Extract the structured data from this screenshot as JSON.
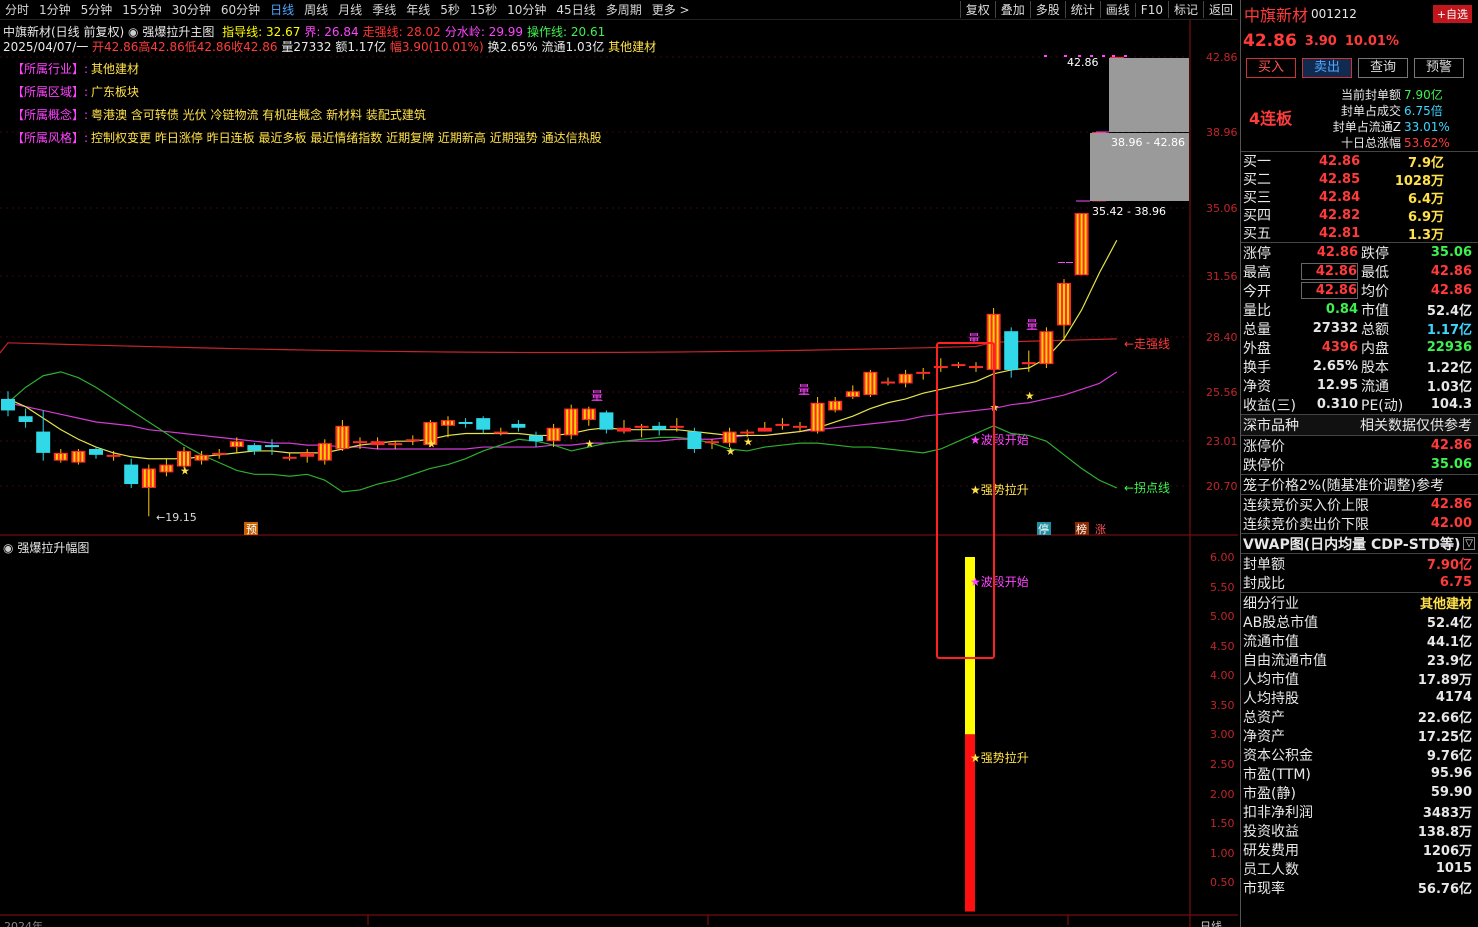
{
  "toolbar": {
    "timeframes": [
      "分时",
      "1分钟",
      "5分钟",
      "15分钟",
      "30分钟",
      "60分钟",
      "日线",
      "周线",
      "月线",
      "季线",
      "年线",
      "5秒",
      "15秒",
      "10分钟",
      "45日线",
      "多周期",
      "更多 >"
    ],
    "active_timeframe": "日线",
    "tools": [
      "复权",
      "叠加",
      "多股",
      "统计",
      "画线",
      "F10",
      "标记",
      "返回"
    ]
  },
  "chart_header": {
    "title": "中旗新材(日线 前复权)",
    "indicator_name": "强爆拉升主图",
    "params": [
      {
        "label": "指导线: 32.67",
        "color": "#ffff00"
      },
      {
        "label": "界: 26.84",
        "color": "#ff44ff"
      },
      {
        "label": "走强线: 28.02",
        "color": "#ff3333"
      },
      {
        "label": "分水岭: 29.99",
        "color": "#ff44ff"
      },
      {
        "label": "操作线: 20.61",
        "color": "#3ef14e"
      }
    ]
  },
  "bar_info": {
    "date": "2025/04/07/一",
    "open": "开42.86",
    "high": "高42.86",
    "low": "低42.86",
    "close": "收42.86",
    "volume": "量27332",
    "amount": "额1.17亿",
    "change": "幅3.90(10.01%)",
    "turnover": "换2.65%",
    "float": "流通1.03亿",
    "industry": "其他建材"
  },
  "tags": [
    {
      "key": "【所属行业】:",
      "value": "其他建材"
    },
    {
      "key": "【所属区域】:",
      "value": "广东板块"
    },
    {
      "key": "【所属概念】:",
      "value": "粤港澳 含可转债 光伏 冷链物流 有机硅概念 新材料 装配式建筑"
    },
    {
      "key": "【所属风格】:",
      "value": "控制权变更 昨日涨停 昨日连板 最近多板 最近情绪指数 近期复牌 近期新高 近期强势 通达信热股"
    }
  ],
  "price_axis": [
    "42.86",
    "38.96",
    "35.06",
    "31.56",
    "28.40",
    "25.56",
    "23.01",
    "20.70"
  ],
  "sub_axis": [
    "6.00",
    "5.50",
    "5.00",
    "4.50",
    "4.00",
    "3.50",
    "3.00",
    "2.50",
    "2.00",
    "1.50",
    "1.00",
    "0.50"
  ],
  "annotations": {
    "low_marker": "←19.15",
    "high_label": "42.86",
    "box1_label": "38.96 - 42.86",
    "box2_label": "35.42 - 38.96",
    "line_strong": "←走强线",
    "line_turn": "←拐点线",
    "wave_start": "★波段开始",
    "strong_rise": "★强势拉升",
    "vol_mark": "量",
    "yu_mark": "预",
    "ting_mark": "停",
    "bang_mark": "榜",
    "zhang_mark": "涨",
    "sub_wave_start": "★波段开始",
    "sub_strong_rise": "★强势拉升"
  },
  "sub_chart": {
    "title": "强爆拉升幅图"
  },
  "bottom_axis": {
    "left": "2024年",
    "right": "日线"
  },
  "quote": {
    "name": "中旗新材",
    "code": "001212",
    "price": "42.86",
    "change": "3.90",
    "pct": "10.01%",
    "add_fav": "+自选",
    "buttons": [
      "买入",
      "卖出",
      "查询",
      "预警"
    ],
    "streak": "4连板",
    "seal": [
      {
        "k": "当前封单额",
        "v": "7.90亿",
        "c": "grn"
      },
      {
        "k": "封单占成交",
        "v": "6.75倍",
        "c": "cyn"
      },
      {
        "k": "封单占流通Z",
        "v": "33.01%",
        "c": "cyn"
      },
      {
        "k": "十日总涨幅",
        "v": "53.62%",
        "c": "red"
      }
    ],
    "bids": [
      {
        "k": "买一",
        "p": "42.86",
        "v": "7.9亿"
      },
      {
        "k": "买二",
        "p": "42.85",
        "v": "1028万"
      },
      {
        "k": "买三",
        "p": "42.84",
        "v": "6.4万"
      },
      {
        "k": "买四",
        "p": "42.82",
        "v": "6.9万"
      },
      {
        "k": "买五",
        "p": "42.81",
        "v": "1.3万"
      }
    ],
    "stats": [
      {
        "k1": "涨停",
        "v1": "42.86",
        "c1": "red",
        "k2": "跌停",
        "v2": "35.06",
        "c2": "grn"
      },
      {
        "k1": "最高",
        "v1": "42.86",
        "c1": "red",
        "k2": "最低",
        "v2": "42.86",
        "c2": "red"
      },
      {
        "k1": "今开",
        "v1": "42.86",
        "c1": "red",
        "k2": "均价",
        "v2": "42.86",
        "c2": "red"
      },
      {
        "k1": "量比",
        "v1": "0.84",
        "c1": "grn",
        "k2": "市值",
        "v2": "52.4亿",
        "c2": "wht"
      },
      {
        "k1": "总量",
        "v1": "27332",
        "c1": "wht",
        "k2": "总额",
        "v2": "1.17亿",
        "c2": "cyn"
      },
      {
        "k1": "外盘",
        "v1": "4396",
        "c1": "red",
        "k2": "内盘",
        "v2": "22936",
        "c2": "grn"
      },
      {
        "k1": "换手",
        "v1": "2.65%",
        "c1": "wht",
        "k2": "股本",
        "v2": "1.22亿",
        "c2": "wht"
      },
      {
        "k1": "净资",
        "v1": "12.95",
        "c1": "wht",
        "k2": "流通",
        "v2": "1.03亿",
        "c2": "wht"
      },
      {
        "k1": "收益(三)",
        "v1": "0.310",
        "c1": "wht",
        "k2": "PE(动)",
        "v2": "104.3",
        "c2": "wht"
      }
    ],
    "section_title": "深市品种",
    "section_sub": "相关数据仅供参考",
    "limits": [
      {
        "k": "涨停价",
        "v": "42.86",
        "c": "red"
      },
      {
        "k": "跌停价",
        "v": "35.06",
        "c": "grn"
      }
    ],
    "cage_title": "笼子价格2%(随基准价调整)参考",
    "cage": [
      {
        "k": "连续竞价买入价上限",
        "v": "42.86",
        "c": "red"
      },
      {
        "k": "连续竞价卖出价下限",
        "v": "42.00",
        "c": "red"
      }
    ],
    "vwap_title": "VWAP图(日内均量 CDP-STD等)",
    "seal2": [
      {
        "k": "封单额",
        "v": "7.90亿",
        "c": "red"
      },
      {
        "k": "封成比",
        "v": "6.75",
        "c": "red"
      }
    ],
    "fundamentals": [
      {
        "k": "细分行业",
        "v": "其他建材",
        "c": "yel"
      },
      {
        "k": "AB股总市值",
        "v": "52.4亿",
        "c": "wht"
      },
      {
        "k": "流通市值",
        "v": "44.1亿",
        "c": "wht"
      },
      {
        "k": "自由流通市值",
        "v": "23.9亿",
        "c": "wht"
      },
      {
        "k": "人均市值",
        "v": "17.89万",
        "c": "wht"
      },
      {
        "k": "人均持股",
        "v": "4174",
        "c": "wht"
      },
      {
        "k": "总资产",
        "v": "22.66亿",
        "c": "wht"
      },
      {
        "k": "净资产",
        "v": "17.25亿",
        "c": "wht"
      },
      {
        "k": "资本公积金",
        "v": "9.76亿",
        "c": "wht"
      },
      {
        "k": "市盈(TTM)",
        "v": "95.96",
        "c": "wht"
      },
      {
        "k": "市盈(静)",
        "v": "59.90",
        "c": "wht"
      },
      {
        "k": "扣非净利润",
        "v": "3483万",
        "c": "wht"
      },
      {
        "k": "投资收益",
        "v": "138.8万",
        "c": "wht"
      },
      {
        "k": "研发费用",
        "v": "1206万",
        "c": "wht"
      },
      {
        "k": "员工人数",
        "v": "1015",
        "c": "wht"
      },
      {
        "k": "市现率",
        "v": "56.76亿",
        "c": "wht"
      }
    ]
  },
  "candles": [
    [
      25.2,
      24.6,
      24.3,
      25.6
    ],
    [
      24.3,
      24.0,
      23.7,
      24.7
    ],
    [
      23.5,
      22.4,
      22.0,
      24.6
    ],
    [
      22.0,
      22.4,
      21.9,
      22.6
    ],
    [
      21.9,
      22.5,
      21.8,
      22.6
    ],
    [
      22.6,
      22.3,
      22.1,
      22.7
    ],
    [
      22.2,
      22.3,
      22.0,
      22.5
    ],
    [
      21.8,
      20.8,
      20.6,
      22.1
    ],
    [
      20.6,
      21.6,
      19.15,
      21.8
    ],
    [
      21.4,
      21.8,
      21.2,
      22.1
    ],
    [
      21.7,
      22.5,
      21.6,
      22.7
    ],
    [
      22.0,
      22.3,
      21.8,
      22.5
    ],
    [
      22.3,
      22.4,
      22.1,
      22.6
    ],
    [
      22.7,
      23.0,
      22.4,
      23.2
    ],
    [
      22.8,
      22.5,
      22.3,
      22.9
    ],
    [
      22.8,
      22.7,
      22.3,
      23.1
    ],
    [
      22.2,
      22.2,
      22.0,
      22.4
    ],
    [
      22.2,
      22.4,
      21.9,
      22.6
    ],
    [
      22.0,
      22.9,
      21.8,
      23.1
    ],
    [
      22.6,
      23.8,
      22.5,
      24.1
    ],
    [
      23.0,
      23.0,
      22.6,
      23.2
    ],
    [
      22.8,
      23.0,
      22.6,
      23.2
    ],
    [
      22.9,
      22.9,
      22.6,
      23.0
    ],
    [
      23.1,
      23.1,
      22.8,
      23.3
    ],
    [
      22.8,
      24.0,
      22.7,
      24.1
    ],
    [
      23.8,
      24.1,
      23.2,
      24.3
    ],
    [
      24.0,
      23.9,
      23.7,
      24.2
    ],
    [
      24.2,
      23.6,
      23.4,
      24.3
    ],
    [
      23.5,
      23.5,
      23.3,
      23.7
    ],
    [
      23.9,
      23.7,
      23.5,
      24.1
    ],
    [
      23.3,
      23.0,
      22.7,
      23.5
    ],
    [
      23.0,
      23.7,
      22.7,
      23.9
    ],
    [
      23.3,
      24.7,
      23.1,
      24.9
    ],
    [
      24.1,
      24.7,
      23.8,
      24.8
    ],
    [
      24.5,
      23.6,
      23.4,
      24.6
    ],
    [
      23.5,
      23.7,
      23.4,
      24.1
    ],
    [
      23.8,
      23.8,
      23.2,
      23.9
    ],
    [
      23.8,
      23.6,
      23.3,
      24.0
    ],
    [
      23.7,
      23.8,
      23.5,
      24.2
    ],
    [
      23.5,
      22.6,
      22.4,
      23.7
    ],
    [
      22.9,
      23.0,
      22.6,
      23.1
    ],
    [
      22.9,
      23.5,
      22.7,
      23.7
    ],
    [
      23.4,
      23.5,
      23.2,
      23.6
    ],
    [
      23.5,
      23.7,
      23.5,
      24.0
    ],
    [
      23.8,
      23.9,
      23.6,
      24.2
    ],
    [
      23.7,
      23.8,
      23.5,
      24.0
    ],
    [
      23.5,
      25.0,
      23.4,
      25.3
    ],
    [
      24.6,
      25.1,
      24.5,
      25.3
    ],
    [
      25.3,
      25.6,
      25.2,
      25.9
    ],
    [
      25.4,
      26.6,
      25.3,
      26.7
    ],
    [
      26.1,
      26.1,
      25.9,
      26.3
    ],
    [
      26.0,
      26.5,
      25.8,
      26.7
    ],
    [
      26.6,
      26.6,
      26.2,
      26.8
    ],
    [
      26.9,
      26.9,
      26.6,
      27.3
    ],
    [
      27.0,
      27.0,
      26.8,
      27.1
    ],
    [
      26.8,
      26.9,
      26.6,
      27.1
    ],
    [
      26.7,
      29.6,
      26.5,
      29.9
    ],
    [
      28.7,
      26.7,
      26.3,
      28.9
    ],
    [
      27.0,
      27.1,
      26.6,
      27.7
    ],
    [
      27.0,
      28.7,
      26.8,
      28.9
    ],
    [
      29.0,
      31.2,
      28.2,
      31.4
    ],
    [
      31.6,
      34.8,
      31.6,
      34.8
    ],
    [
      35.4,
      38.96,
      35.4,
      38.96
    ],
    [
      42.86,
      42.86,
      42.86,
      42.86
    ]
  ]
}
